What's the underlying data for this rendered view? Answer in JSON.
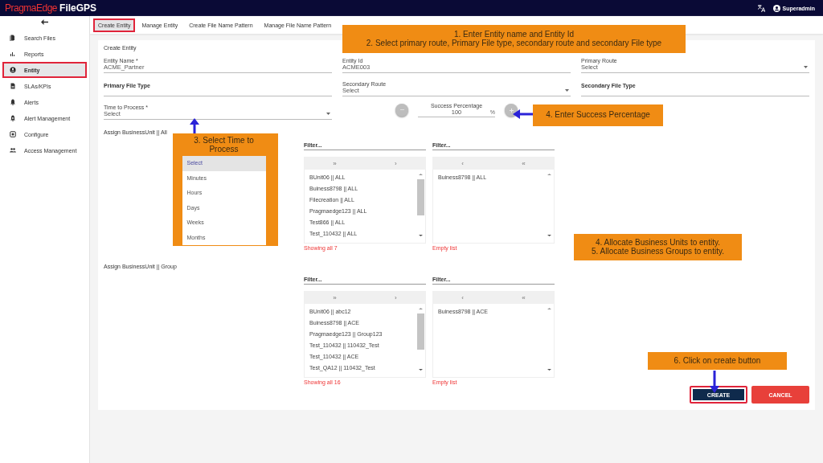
{
  "header": {
    "brand": "PragmaEdge",
    "product": "FileGPS",
    "user": "Superadmin"
  },
  "sidebar": {
    "items": [
      {
        "label": "Search Files",
        "selected": false,
        "highlighted": false
      },
      {
        "label": "Reports",
        "selected": false,
        "highlighted": false
      },
      {
        "label": "Entity",
        "selected": true,
        "highlighted": true
      },
      {
        "label": "SLAs/KPIs",
        "selected": false,
        "highlighted": false
      },
      {
        "label": "Alerts",
        "selected": false,
        "highlighted": false
      },
      {
        "label": "Alert Management",
        "selected": false,
        "highlighted": false
      },
      {
        "label": "Configure",
        "selected": false,
        "highlighted": false
      },
      {
        "label": "Access Management",
        "selected": false,
        "highlighted": false
      }
    ]
  },
  "tabs": [
    {
      "label": "Create Entity",
      "selected": true,
      "highlighted": true
    },
    {
      "label": "Manage Entity",
      "selected": false,
      "highlighted": false
    },
    {
      "label": "Create File Name Pattern",
      "selected": false,
      "highlighted": false
    },
    {
      "label": "Manage File Name Pattern",
      "selected": false,
      "highlighted": false
    }
  ],
  "form": {
    "title": "Create Entity",
    "fields": [
      {
        "kind": "text",
        "label": "Entity Name *",
        "value": "ACME_Partner"
      },
      {
        "kind": "text",
        "label": "Entity Id",
        "value": "ACME003"
      },
      {
        "kind": "select",
        "label": "Primary Route",
        "value": "Select"
      },
      {
        "kind": "plain",
        "label": "Primary File Type"
      },
      {
        "kind": "select",
        "label": "Secondary Route",
        "value": "Select"
      },
      {
        "kind": "plain",
        "label": "Secondary File Type"
      },
      {
        "kind": "select",
        "label": "Time to Process *",
        "value": "Select"
      }
    ],
    "success": {
      "label": "Success Percentage",
      "value": "100",
      "unit": "%"
    },
    "time_menu": [
      {
        "label": "Select",
        "selected": true
      },
      {
        "label": "Minutes",
        "selected": false
      },
      {
        "label": "Hours",
        "selected": false
      },
      {
        "label": "Days",
        "selected": false
      },
      {
        "label": "Weeks",
        "selected": false
      },
      {
        "label": "Months",
        "selected": false
      }
    ],
    "assign": [
      {
        "title": "Assign BusinessUnit || All",
        "source": {
          "filter_placeholder": "Filter...",
          "move_all": "»",
          "move": "›",
          "items": [
            "BUnit06 || ALL",
            "Buiness8798 || ALL",
            "Filecreation || ALL",
            "Pragmaedge123 || ALL",
            "Test866 || ALL",
            "Test_110432 || ALL"
          ],
          "footer": "Showing all 7"
        },
        "target": {
          "filter_placeholder": "Filter...",
          "move": "‹",
          "move_all": "«",
          "items": [
            "Buiness8798 || ALL"
          ],
          "footer": "Empty list"
        }
      },
      {
        "title": "Assign BusinessUnit || Group",
        "source": {
          "filter_placeholder": "Filter...",
          "move_all": "»",
          "move": "›",
          "items": [
            "BUnit06 || abc12",
            "Buiness8798 || ACE",
            "Pragmaedge123 || Group123",
            "Test_110432 || 110432_Test",
            "Test_110432 || ACE",
            "Test_QA12 || 110432_Test"
          ],
          "footer": "Showing all 16"
        },
        "target": {
          "filter_placeholder": "Filter...",
          "move": "‹",
          "move_all": "«",
          "items": [
            "Buiness8798 || ACE"
          ],
          "footer": "Empty list"
        }
      }
    ],
    "buttons": [
      {
        "kind": "primary",
        "label": "CREATE",
        "highlighted": true
      },
      {
        "kind": "danger",
        "label": "CANCEL",
        "highlighted": false
      }
    ]
  },
  "annotations": [
    {
      "lines": [
        "1. Enter Entity name and Entity Id",
        "2. Select primary route, Primary File type, secondary route and secondary File type"
      ]
    },
    {
      "lines": [
        "3. Select Time to Process"
      ]
    },
    {
      "lines": [
        "4. Enter Success Percentage"
      ]
    },
    {
      "lines": [
        "4. Allocate Business Units to entity.",
        "5. Allocate Business Groups to entity."
      ]
    },
    {
      "lines": [
        "6. Click on create button"
      ]
    }
  ]
}
